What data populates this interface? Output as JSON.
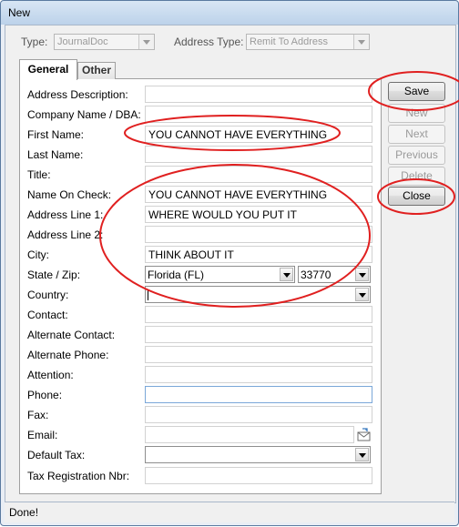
{
  "window": {
    "title": "New"
  },
  "header": {
    "type_label": "Type:",
    "type_value": "JournalDoc",
    "address_type_label": "Address Type:",
    "address_type_value": "Remit To Address"
  },
  "tabs": [
    {
      "label": "General"
    },
    {
      "label": "Other"
    }
  ],
  "form": {
    "address_description": {
      "label": "Address Description:",
      "value": ""
    },
    "company_name": {
      "label": "Company Name / DBA:",
      "value": ""
    },
    "first_name": {
      "label": "First Name:",
      "value": "YOU CANNOT HAVE EVERYTHING"
    },
    "last_name": {
      "label": "Last Name:",
      "value": ""
    },
    "title": {
      "label": "Title:",
      "value": ""
    },
    "name_on_check": {
      "label": "Name On Check:",
      "value": "YOU CANNOT HAVE EVERYTHING"
    },
    "address_line_1": {
      "label": "Address Line 1:",
      "value": "WHERE WOULD YOU PUT IT"
    },
    "address_line_2": {
      "label": "Address Line 2:",
      "value": ""
    },
    "city": {
      "label": "City:",
      "value": "THINK ABOUT IT"
    },
    "state_zip": {
      "label": "State / Zip:",
      "state": "Florida (FL)",
      "zip": "33770"
    },
    "country": {
      "label": "Country:",
      "value": ""
    },
    "contact": {
      "label": "Contact:",
      "value": ""
    },
    "alternate_contact": {
      "label": "Alternate Contact:",
      "value": ""
    },
    "alternate_phone": {
      "label": "Alternate Phone:",
      "value": ""
    },
    "attention": {
      "label": "Attention:",
      "value": ""
    },
    "phone": {
      "label": "Phone:",
      "value": ""
    },
    "fax": {
      "label": "Fax:",
      "value": ""
    },
    "email": {
      "label": "Email:",
      "value": ""
    },
    "default_tax": {
      "label": "Default Tax:",
      "value": ""
    },
    "tax_registration": {
      "label": "Tax Registration Nbr:",
      "value": ""
    }
  },
  "buttons": {
    "save": "Save",
    "new": "New",
    "next": "Next",
    "previous": "Previous",
    "delete": "Delete",
    "close": "Close"
  },
  "status": {
    "text": "Done!"
  },
  "colors": {
    "annotation": "#e02020",
    "focus_border": "#7aa7d8",
    "window_frame": "#5a7aa0"
  },
  "icons": {
    "email_action": "envelope-icon"
  }
}
